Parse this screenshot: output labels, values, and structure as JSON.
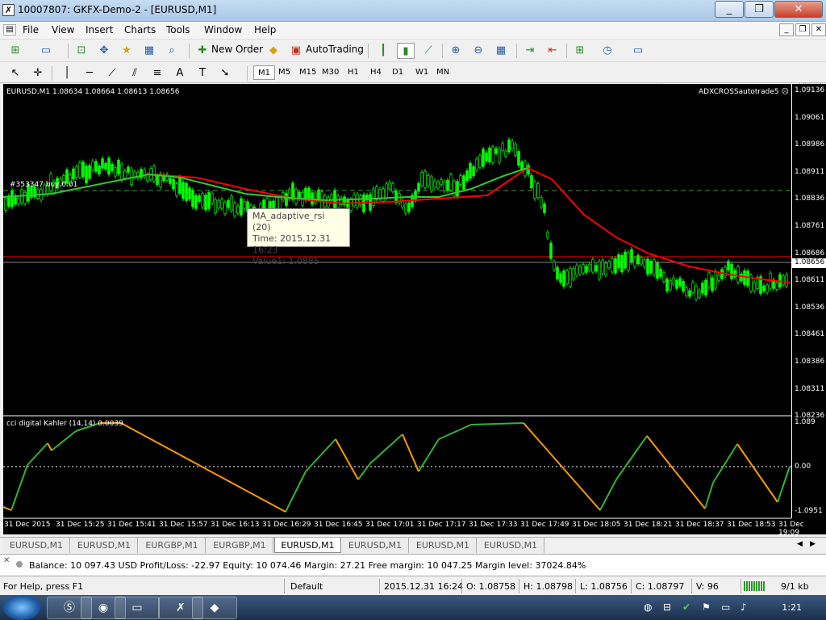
{
  "window": {
    "title": "10007807: GKFX-Demo-2 - [EURUSD,M1]",
    "minimize": "_",
    "restore": "❐",
    "close": "✕"
  },
  "menu": [
    "File",
    "View",
    "Insert",
    "Charts",
    "Tools",
    "Window",
    "Help"
  ],
  "toolbar": {
    "new_order": "New Order",
    "auto_trading": "AutoTrading"
  },
  "timeframes": [
    "M1",
    "M5",
    "M15",
    "M30",
    "H1",
    "H4",
    "D1",
    "W1",
    "MN"
  ],
  "active_timeframe": "M1",
  "search": {
    "placeholder": ""
  },
  "chart": {
    "symbol_info": "EURUSD,M1  1.08634 1.08664 1.08613 1.08656",
    "expert_label": "ADXCROSSautotrade5 ☹",
    "order_label": "#353347 buy 0.01",
    "current_price": "1.08656",
    "price_ticks": [
      "1.09136",
      "1.09061",
      "1.08986",
      "1.08911",
      "1.08836",
      "1.08761",
      "1.08686",
      "1.08611",
      "1.08536",
      "1.08461",
      "1.08386",
      "1.08311",
      "1.08236"
    ],
    "indicator_label": "cci digital Kahler (14,14) 0.0039",
    "indicator_ticks": [
      "1.089",
      "0.00",
      "-1.0951"
    ],
    "time_ticks": [
      "31 Dec 2015",
      "31 Dec 15:25",
      "31 Dec 15:41",
      "31 Dec 15:57",
      "31 Dec 16:13",
      "31 Dec 16:29",
      "31 Dec 16:45",
      "31 Dec 17:01",
      "31 Dec 17:17",
      "31 Dec 17:33",
      "31 Dec 17:49",
      "31 Dec 18:05",
      "31 Dec 18:21",
      "31 Dec 18:37",
      "31 Dec 18:53",
      "31 Dec 19:09"
    ],
    "tooltip": {
      "line1": "MA_adaptive_rsi (20)",
      "line2": "Time: 2015.12.31 16:23",
      "line3": "Value1: 1.0885"
    },
    "colors": {
      "bull": "#00ff00",
      "ma": "#ff0000",
      "cci_up": "#32b432",
      "cci_down": "#ff9a00"
    }
  },
  "chart_tabs": [
    "EURUSD,M1",
    "EURUSD,M1",
    "EURGBP,M1",
    "EURGBP,M1",
    "EURUSD,M1",
    "EURUSD,M1",
    "EURUSD,M1",
    "EURUSD,M1"
  ],
  "active_tab": 4,
  "terminal": {
    "summary": "Balance: 10 097.43 USD  Profit/Loss: -22.97  Equity: 10 074.46  Margin: 27.21  Free margin: 10 047.25  Margin level: 37024.84%"
  },
  "status": {
    "help": "For Help, press F1",
    "profile": "Default",
    "datetime": "2015.12.31 16:24",
    "open": "O: 1.08758",
    "high": "H: 1.08798",
    "low": "L: 1.08756",
    "close": "C: 1.08797",
    "volume": "V: 96",
    "traffic": "9/1 kb"
  },
  "taskbar": {
    "clock": "1:21"
  }
}
